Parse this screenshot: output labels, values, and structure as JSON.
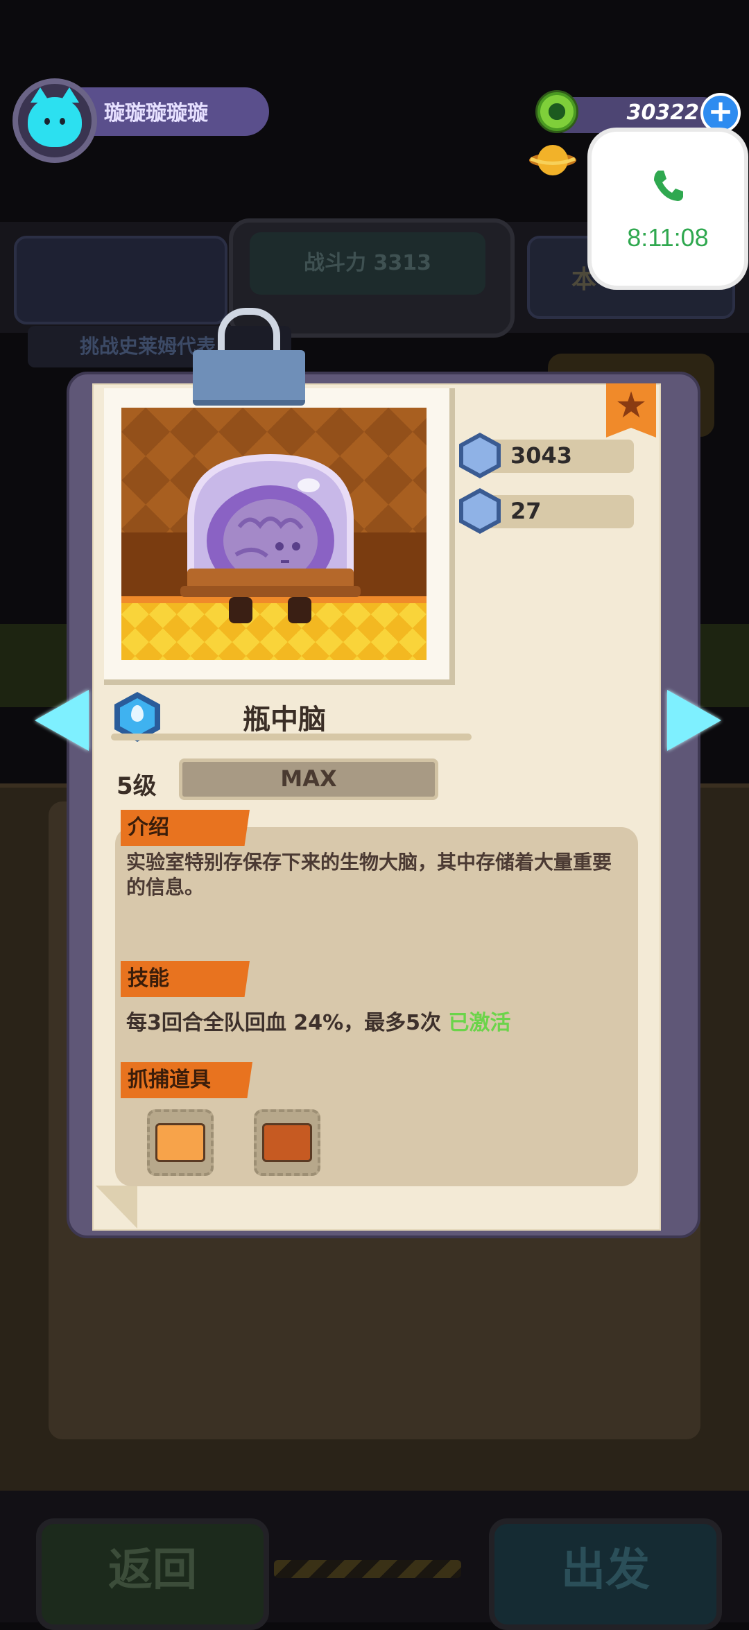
{
  "profile": {
    "name": "璇璇璇璇璇"
  },
  "currency": {
    "coins": "30322",
    "plus_label": "+"
  },
  "call": {
    "time": "8:11:08"
  },
  "background": {
    "power_label": "战斗力 3313",
    "challenge_label": "挑战史莱姆代表",
    "right_label": "本"
  },
  "bottom_buttons": {
    "back": "返回",
    "go": "出发"
  },
  "card": {
    "name": "瓶中脑",
    "stats": {
      "attack": "3043",
      "defense": "27"
    },
    "level_label": "5级",
    "level_status": "MAX",
    "sections": {
      "intro_title": "介绍",
      "intro_text": "实验室特别存保存下来的生物大脑，其中存储着大量重要的信息。",
      "skill_title": "技能",
      "skill_text": "每3回合全队回血 24%，最多5次",
      "skill_status": "已激活",
      "capture_title": "抓捕道具"
    }
  },
  "colors": {
    "accent_orange": "#e8731f",
    "arrow_cyan": "#7ef0ff",
    "skill_active_green": "#6bd44a",
    "call_green": "#2fa84f"
  },
  "icons": {
    "element": "water-drop-icon",
    "attack": "sword-icon",
    "defense": "shield-sword-icon",
    "favorite": "star-icon",
    "call": "phone-icon"
  }
}
